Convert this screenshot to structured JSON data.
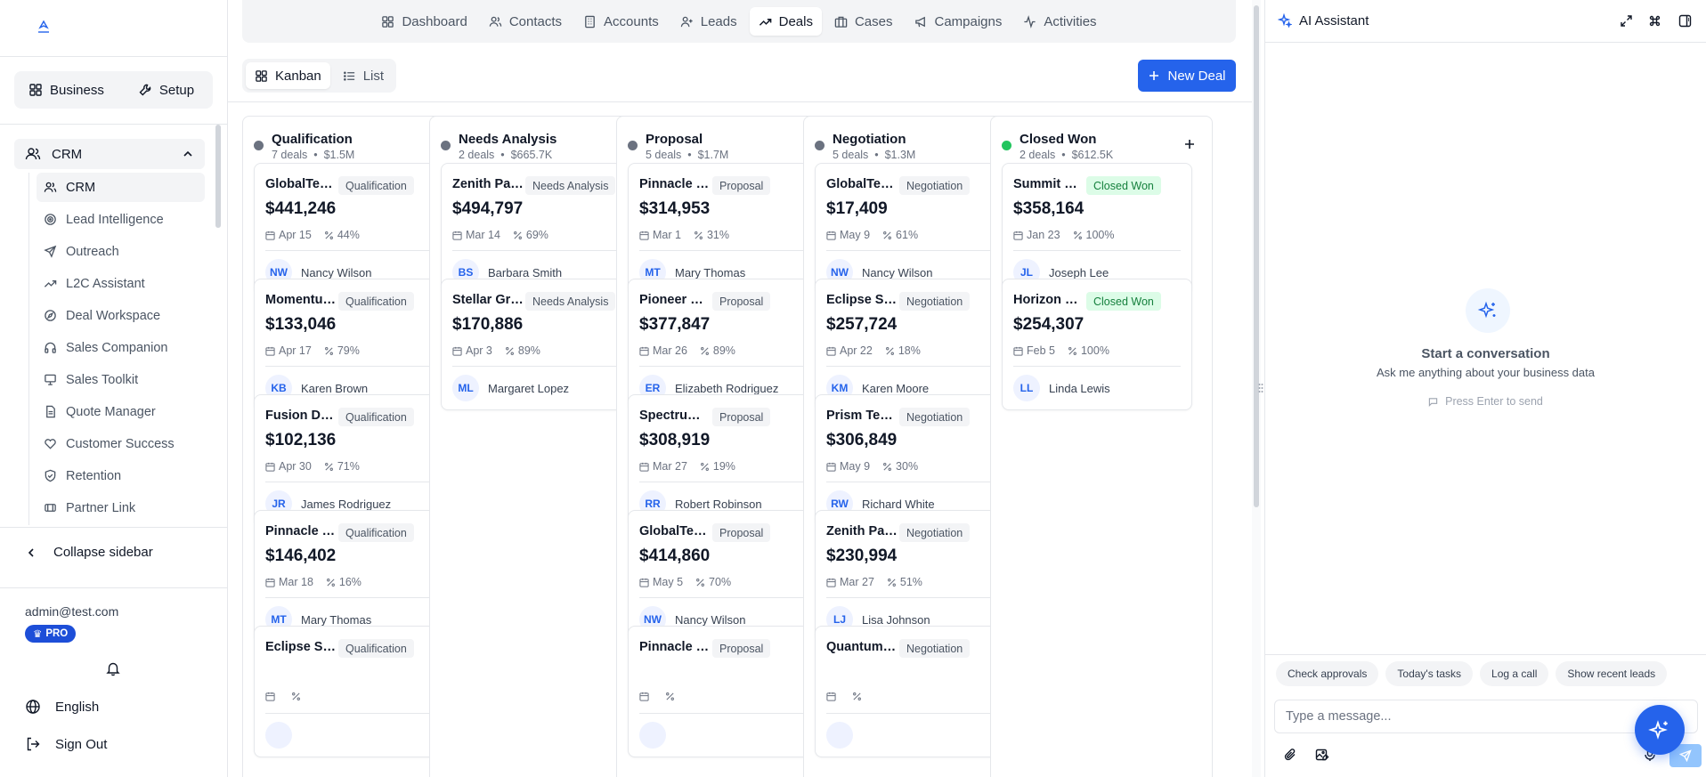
{
  "sidebar": {
    "modes": [
      {
        "label": "Business",
        "icon": "grid-icon"
      },
      {
        "label": "Setup",
        "icon": "wrench-icon"
      }
    ],
    "section_label": "CRM",
    "items": [
      {
        "label": "CRM",
        "icon": "users-icon",
        "active": true
      },
      {
        "label": "Lead Intelligence",
        "icon": "target-icon"
      },
      {
        "label": "Outreach",
        "icon": "send-icon"
      },
      {
        "label": "L2C Assistant",
        "icon": "trending-up-icon"
      },
      {
        "label": "Deal Workspace",
        "icon": "compass-icon"
      },
      {
        "label": "Sales Companion",
        "icon": "headphones-icon"
      },
      {
        "label": "Sales Toolkit",
        "icon": "presentation-icon"
      },
      {
        "label": "Quote Manager",
        "icon": "document-icon"
      },
      {
        "label": "Customer Success",
        "icon": "heart-icon"
      },
      {
        "label": "Retention",
        "icon": "shield-check-icon"
      },
      {
        "label": "Partner Link",
        "icon": "handshake-icon"
      }
    ],
    "collapse_label": "Collapse sidebar",
    "user_email": "admin@test.com",
    "plan_badge": "PRO",
    "language_label": "English",
    "sign_out_label": "Sign Out"
  },
  "top_tabs": [
    {
      "label": "Dashboard",
      "icon": "grid-icon"
    },
    {
      "label": "Contacts",
      "icon": "users-icon"
    },
    {
      "label": "Accounts",
      "icon": "building-icon"
    },
    {
      "label": "Leads",
      "icon": "user-plus-icon"
    },
    {
      "label": "Deals",
      "icon": "trending-up-icon",
      "active": true
    },
    {
      "label": "Cases",
      "icon": "briefcase-icon"
    },
    {
      "label": "Campaigns",
      "icon": "megaphone-icon"
    },
    {
      "label": "Activities",
      "icon": "activity-icon"
    }
  ],
  "view_switch": {
    "kanban_label": "Kanban",
    "list_label": "List",
    "active": "kanban"
  },
  "new_deal_label": "New Deal",
  "colors": {
    "primary": "#2563eb",
    "stage_dot": "#6b7280",
    "won_dot": "#22c55e"
  },
  "columns": [
    {
      "title": "Qualification",
      "deal_count": "7 deals",
      "total": "$1.5M",
      "dot": "#6b7280",
      "cards": [
        {
          "name": "GlobalTech Industries",
          "stage": "Qualification",
          "amount": "$441,246",
          "date": "Apr 15",
          "prob": "44%",
          "initials": "NW",
          "owner": "Nancy Wilson"
        },
        {
          "name": "Momentum Corp",
          "stage": "Qualification",
          "amount": "$133,046",
          "date": "Apr 17",
          "prob": "79%",
          "initials": "KB",
          "owner": "Karen Brown"
        },
        {
          "name": "Fusion Dynamics",
          "stage": "Qualification",
          "amount": "$102,136",
          "date": "Apr 30",
          "prob": "71%",
          "initials": "JR",
          "owner": "James Rodriguez"
        },
        {
          "name": "Pinnacle Industries",
          "stage": "Qualification",
          "amount": "$146,402",
          "date": "Mar 18",
          "prob": "16%",
          "initials": "MT",
          "owner": "Mary Thomas"
        },
        {
          "name": "Eclipse Systems",
          "stage": "Qualification",
          "amount": "",
          "date": "",
          "prob": "",
          "initials": "",
          "owner": ""
        }
      ]
    },
    {
      "title": "Needs Analysis",
      "deal_count": "2 deals",
      "total": "$665.7K",
      "dot": "#6b7280",
      "cards": [
        {
          "name": "Zenith Partners",
          "stage": "Needs Analysis",
          "amount": "$494,797",
          "date": "Mar 14",
          "prob": "69%",
          "initials": "BS",
          "owner": "Barbara Smith"
        },
        {
          "name": "Stellar Group",
          "stage": "Needs Analysis",
          "amount": "$170,886",
          "date": "Apr 3",
          "prob": "89%",
          "initials": "ML",
          "owner": "Margaret Lopez"
        }
      ]
    },
    {
      "title": "Proposal",
      "deal_count": "5 deals",
      "total": "$1.7M",
      "dot": "#6b7280",
      "cards": [
        {
          "name": "Pinnacle Industries",
          "stage": "Proposal",
          "amount": "$314,953",
          "date": "Mar 1",
          "prob": "31%",
          "initials": "MT",
          "owner": "Mary Thomas"
        },
        {
          "name": "Pioneer Digital",
          "stage": "Proposal",
          "amount": "$377,847",
          "date": "Mar 26",
          "prob": "89%",
          "initials": "ER",
          "owner": "Elizabeth Rodriguez"
        },
        {
          "name": "Spectrum Inc",
          "stage": "Proposal",
          "amount": "$308,919",
          "date": "Mar 27",
          "prob": "19%",
          "initials": "RR",
          "owner": "Robert Robinson"
        },
        {
          "name": "GlobalTech Industries",
          "stage": "Proposal",
          "amount": "$414,860",
          "date": "May 5",
          "prob": "70%",
          "initials": "NW",
          "owner": "Nancy Wilson"
        },
        {
          "name": "Pinnacle Industries",
          "stage": "Proposal",
          "amount": "",
          "date": "",
          "prob": "",
          "initials": "",
          "owner": ""
        }
      ]
    },
    {
      "title": "Negotiation",
      "deal_count": "5 deals",
      "total": "$1.3M",
      "dot": "#6b7280",
      "cards": [
        {
          "name": "GlobalTech Industries",
          "stage": "Negotiation",
          "amount": "$17,409",
          "date": "May 9",
          "prob": "61%",
          "initials": "NW",
          "owner": "Nancy Wilson"
        },
        {
          "name": "Eclipse Systems",
          "stage": "Negotiation",
          "amount": "$257,724",
          "date": "Apr 22",
          "prob": "18%",
          "initials": "KM",
          "owner": "Karen Moore"
        },
        {
          "name": "Prism Technologies",
          "stage": "Negotiation",
          "amount": "$306,849",
          "date": "May 9",
          "prob": "30%",
          "initials": "RW",
          "owner": "Richard White"
        },
        {
          "name": "Zenith Partners",
          "stage": "Negotiation",
          "amount": "$230,994",
          "date": "Mar 27",
          "prob": "51%",
          "initials": "LJ",
          "owner": "Lisa Johnson"
        },
        {
          "name": "Quantum Labs",
          "stage": "Negotiation",
          "amount": "",
          "date": "",
          "prob": "",
          "initials": "",
          "owner": ""
        }
      ]
    },
    {
      "title": "Closed Won",
      "deal_count": "2 deals",
      "total": "$612.5K",
      "dot": "#22c55e",
      "cards": [
        {
          "name": "Summit Holdings",
          "stage": "Closed Won",
          "amount": "$358,164",
          "date": "Jan 23",
          "prob": "100%",
          "initials": "JL",
          "owner": "Joseph Lee",
          "won": true
        },
        {
          "name": "Horizon Group",
          "stage": "Closed Won",
          "amount": "$254,307",
          "date": "Feb 5",
          "prob": "100%",
          "initials": "LL",
          "owner": "Linda Lewis",
          "won": true
        }
      ]
    }
  ],
  "ai": {
    "title": "AI Assistant",
    "empty_title": "Start a conversation",
    "empty_subtitle": "Ask me anything about your business data",
    "empty_hint": "Press Enter to send",
    "quick_actions": [
      "Check approvals",
      "Today's tasks",
      "Log a call",
      "Show recent leads"
    ],
    "input_placeholder": "Type a message..."
  }
}
